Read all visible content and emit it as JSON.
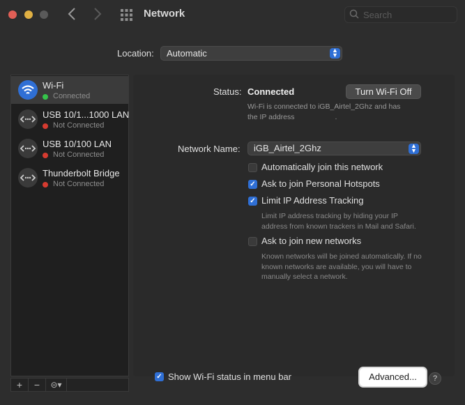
{
  "window": {
    "title": "Network"
  },
  "search": {
    "placeholder": "Search"
  },
  "location": {
    "label": "Location:",
    "value": "Automatic"
  },
  "sidebar": {
    "services": [
      {
        "name": "Wi-Fi",
        "status": "Connected",
        "status_color": "#35c44a",
        "icon": "wifi-icon"
      },
      {
        "name": "USB 10/1...1000 LAN",
        "status": "Not Connected",
        "status_color": "#d63b30",
        "icon": "ethernet-icon"
      },
      {
        "name": "USB 10/100 LAN",
        "status": "Not Connected",
        "status_color": "#d63b30",
        "icon": "ethernet-icon"
      },
      {
        "name": "Thunderbolt Bridge",
        "status": "Not Connected",
        "status_color": "#d63b30",
        "icon": "ethernet-icon"
      }
    ],
    "add_label": "+",
    "remove_label": "−",
    "action_label": "⊝▾"
  },
  "detail": {
    "status_label": "Status:",
    "status_value": "Connected",
    "turn_off_label": "Turn Wi-Fi Off",
    "status_desc_line1": "Wi-Fi is connected to iGB_Airtel_2Ghz and has",
    "status_desc_line2": "the IP address",
    "status_desc_suffix": ".",
    "network_name_label": "Network Name:",
    "network_name_value": "iGB_Airtel_2Ghz",
    "options": [
      {
        "label": "Automatically join this network",
        "checked": false
      },
      {
        "label": "Ask to join Personal Hotspots",
        "checked": true
      },
      {
        "label": "Limit IP Address Tracking",
        "checked": true
      },
      {
        "label": "Ask to join new networks",
        "checked": false
      }
    ],
    "limit_ip_desc_1": "Limit IP address tracking by hiding your IP",
    "limit_ip_desc_2": "address from known trackers in Mail and Safari.",
    "new_networks_desc_1": "Known networks will be joined automatically. If no",
    "new_networks_desc_2": "known networks are available, you will have to",
    "new_networks_desc_3": "manually select a network."
  },
  "footer": {
    "show_status_label": "Show Wi-Fi status in menu bar",
    "show_status_checked": true,
    "advanced_label": "Advanced...",
    "help_label": "?"
  },
  "colors": {
    "accent": "#2f6fd5",
    "connected": "#35c44a",
    "disconnected": "#d63b30"
  }
}
